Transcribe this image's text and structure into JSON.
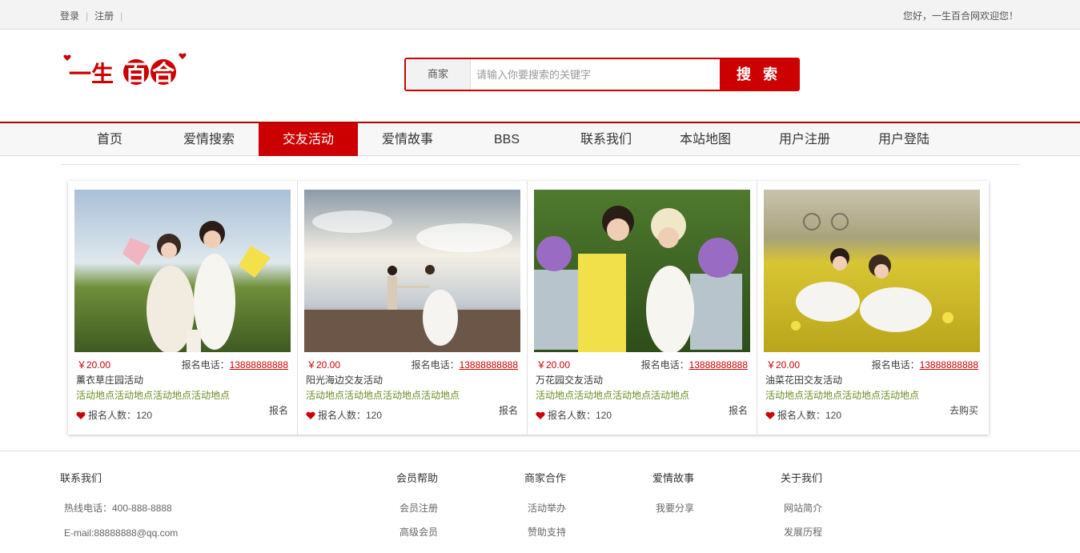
{
  "topbar": {
    "login": "登录",
    "register": "注册",
    "welcome": "您好，一生百合网欢迎您！"
  },
  "header": {
    "logo_text": "一生百合",
    "search": {
      "category": "商家",
      "placeholder": "请输入你要搜索的关键字",
      "button": "搜 索"
    }
  },
  "nav": {
    "items": [
      {
        "label": "首页"
      },
      {
        "label": "爱情搜索"
      },
      {
        "label": "交友活动"
      },
      {
        "label": "爱情故事"
      },
      {
        "label": "BBS"
      },
      {
        "label": "联系我们"
      },
      {
        "label": "本站地图"
      },
      {
        "label": "用户注册"
      },
      {
        "label": "用户登陆"
      }
    ],
    "active_index": 2
  },
  "activities": [
    {
      "price": "￥20.00",
      "phone_label": "报名电话：",
      "phone": "13888888888",
      "title": "薰衣草庄园活动",
      "address": "活动地点活动地点活动地点活动地点",
      "count": "报名人数：120",
      "action": "报名"
    },
    {
      "price": "￥20.00",
      "phone_label": "报名电话：",
      "phone": "13888888888",
      "title": "阳光海边交友活动",
      "address": "活动地点活动地点活动地点活动地点",
      "count": "报名人数：120",
      "action": "报名"
    },
    {
      "price": "￥20.00",
      "phone_label": "报名电话：",
      "phone": "13888888888",
      "title": "万花园交友活动",
      "address": "活动地点活动地点活动地点活动地点",
      "count": "报名人数：120",
      "action": "报名"
    },
    {
      "price": "￥20.00",
      "phone_label": "报名电话：",
      "phone": "13888888888",
      "title": "油菜花田交友活动",
      "address": "活动地点活动地点活动地点活动地点",
      "count": "报名人数：120",
      "action": "去购买"
    }
  ],
  "footer": {
    "contact": {
      "title": "联系我们",
      "hotline": "热线电话：400-888-8888",
      "email": "E-mail:88888888@qq.com"
    },
    "help": {
      "title": "会员帮助",
      "links": [
        "会员注册",
        "高级会员"
      ]
    },
    "biz": {
      "title": "商家合作",
      "links": [
        "活动举办",
        "赞助支持"
      ]
    },
    "story": {
      "title": "爱情故事",
      "links": [
        "我要分享"
      ]
    },
    "about": {
      "title": "关于我们",
      "links": [
        "网站简介",
        "发展历程"
      ]
    }
  },
  "colors": {
    "brand_red": "#cc0000",
    "address_green": "#6b8e23"
  }
}
